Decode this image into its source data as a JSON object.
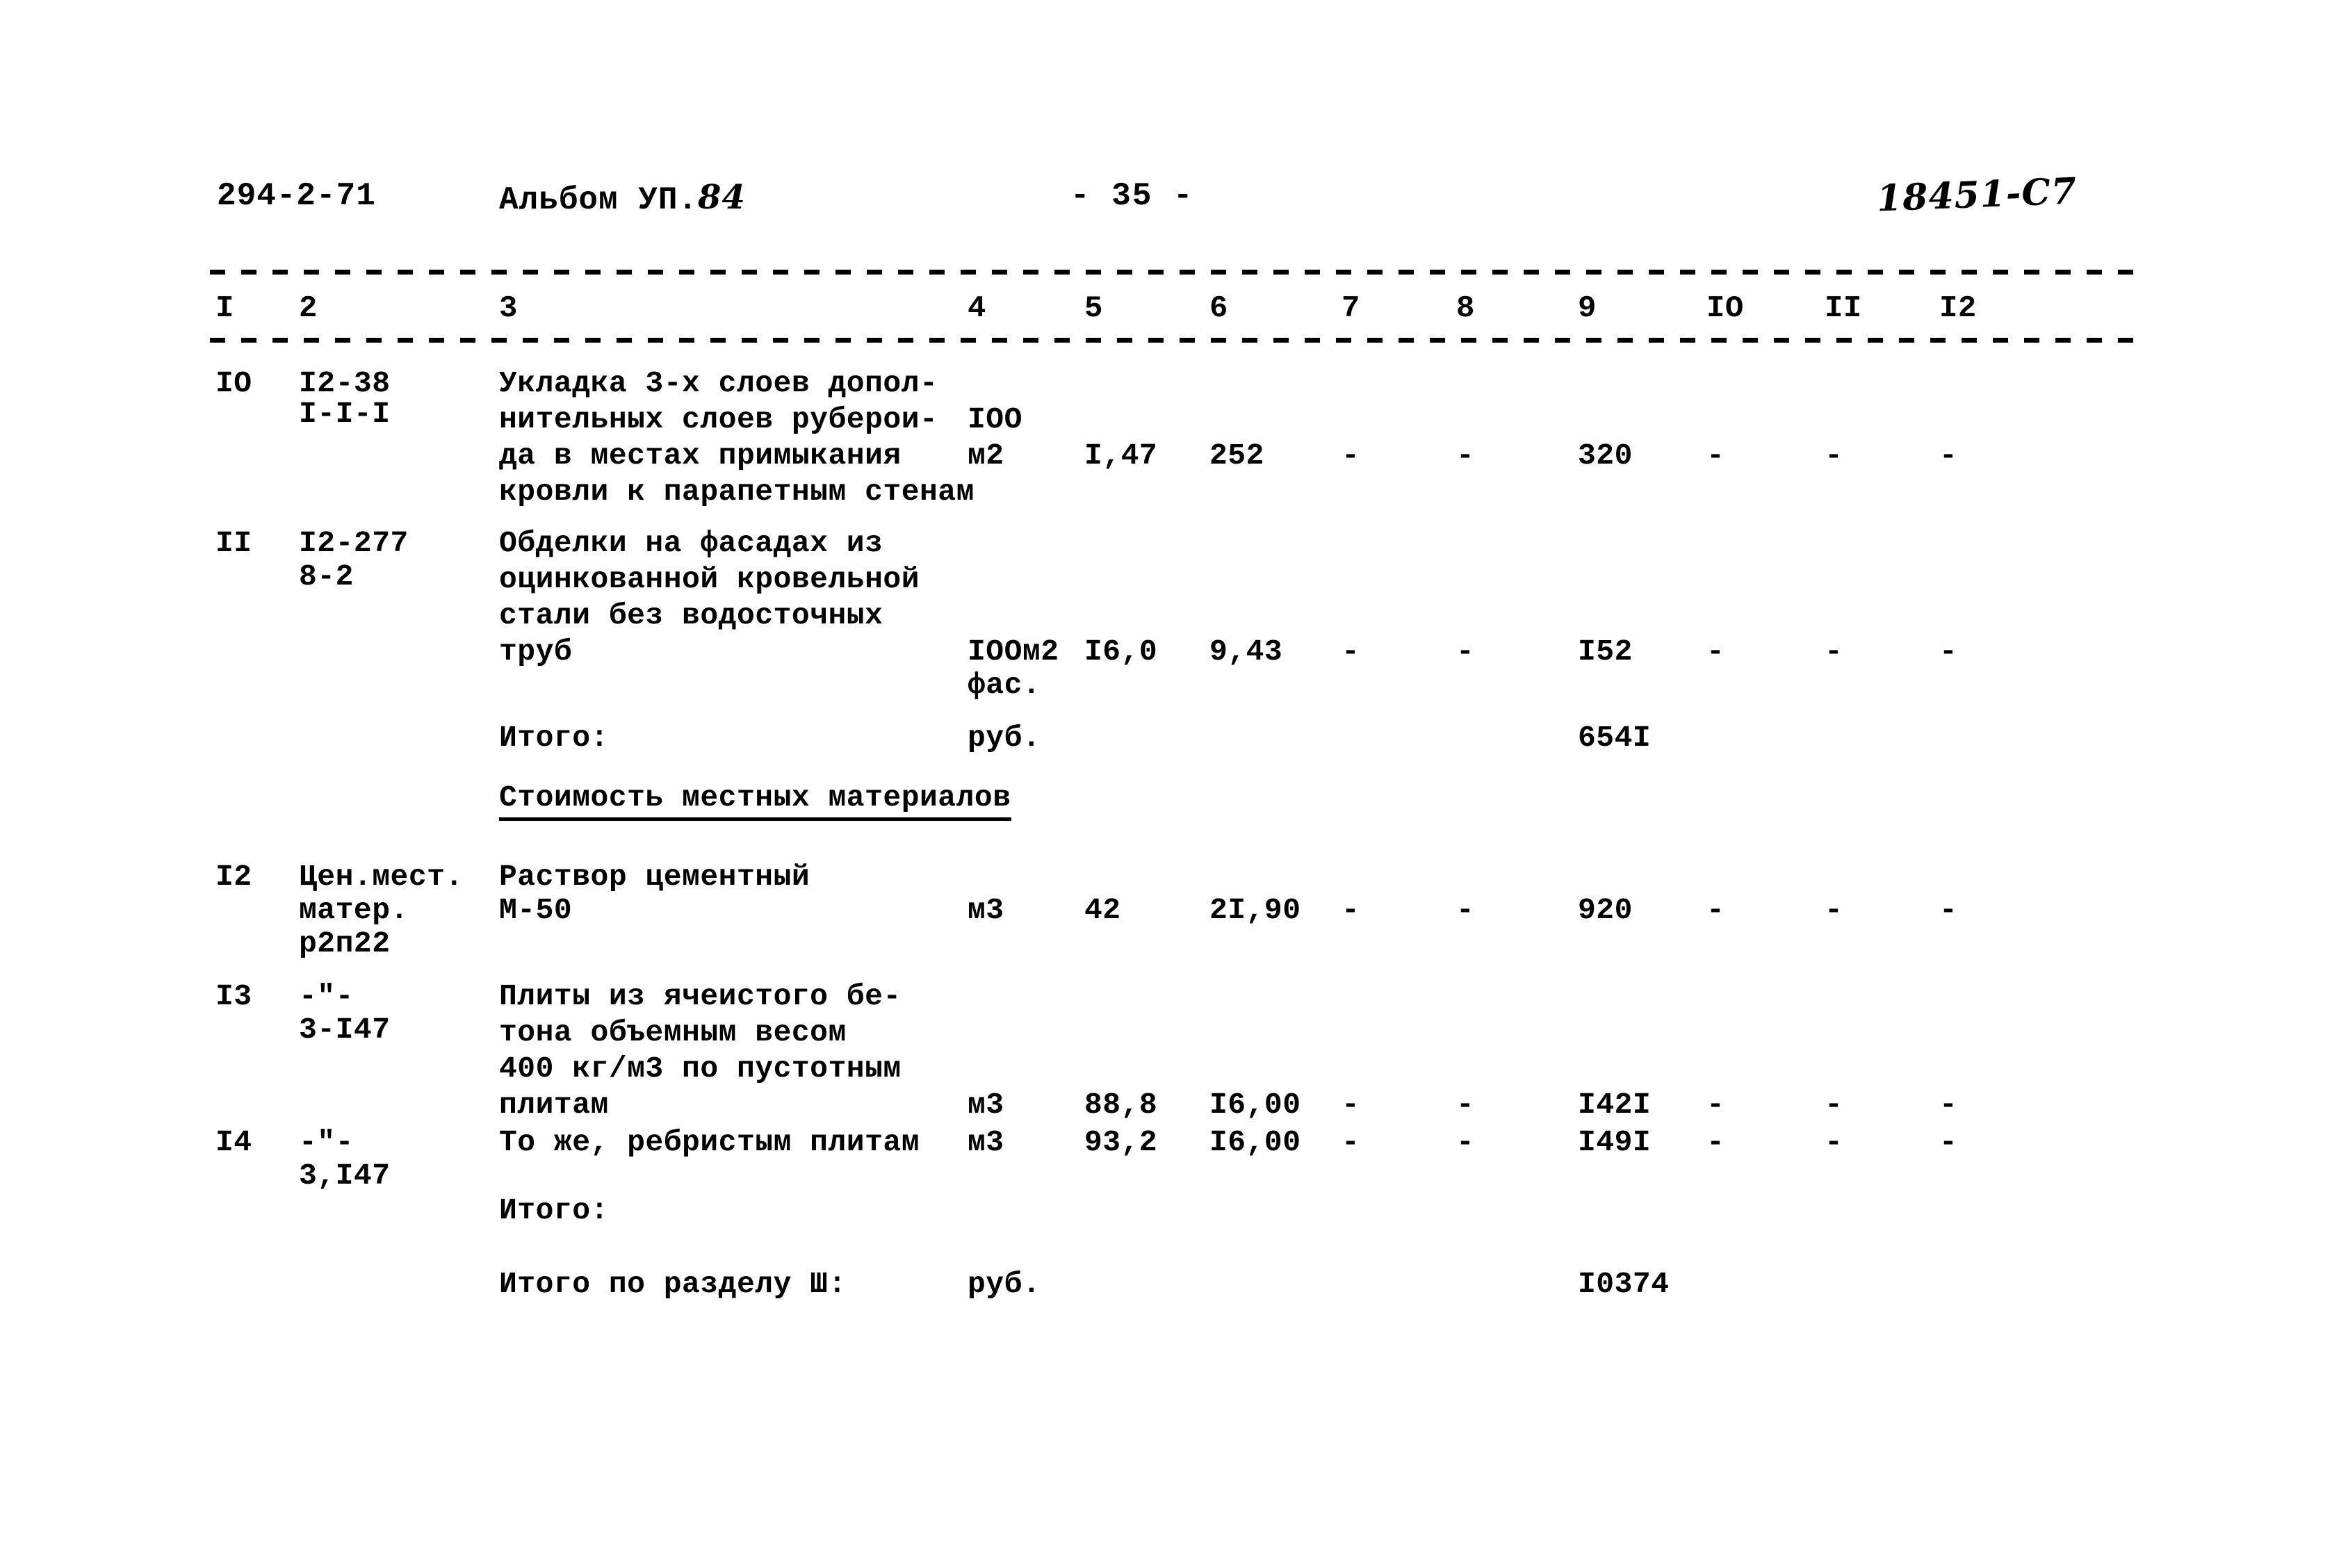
{
  "header": {
    "doc_code": "294-2-71",
    "album_label": "Альбом УП.",
    "album_number": "84",
    "page_marker": "- 35 -",
    "stamp": "18451-С7"
  },
  "table": {
    "column_numbers": [
      "I",
      "2",
      "3",
      "4",
      "5",
      "6",
      "7",
      "8",
      "9",
      "IO",
      "II",
      "I2"
    ],
    "rows": [
      {
        "num": "IO",
        "code_lines": [
          "I2-38",
          "I-I-I"
        ],
        "description_lines": [
          "Укладка 3-х слоев допол-",
          "нительных слоев руберои-",
          "да в местах примыкания",
          "кровли к парапетным стенам"
        ],
        "unit_lines": [
          "IOO",
          "м2"
        ],
        "qty": "I,47",
        "price": "252",
        "c7": "-",
        "c8": "-",
        "total": "320",
        "c10": "-",
        "c11": "-",
        "c12": "-"
      },
      {
        "num": "II",
        "code_lines": [
          "I2-277",
          "8-2"
        ],
        "description_lines": [
          "Обделки на фасадах из",
          "оцинкованной кровельной",
          "стали без водосточных",
          "труб"
        ],
        "unit_lines": [
          "IOOм2",
          "фас."
        ],
        "qty": "I6,0",
        "price": "9,43",
        "c7": "-",
        "c8": "-",
        "total": "I52",
        "c10": "-",
        "c11": "-",
        "c12": "-"
      },
      {
        "num": "I2",
        "code_lines": [
          "Цен.мест.",
          "матер.",
          "р2п22"
        ],
        "description_lines": [
          "Раствор цементный",
          "М-50"
        ],
        "unit_lines": [
          "м3"
        ],
        "qty": "42",
        "price": "2I,90",
        "c7": "-",
        "c8": "-",
        "total": "920",
        "c10": "-",
        "c11": "-",
        "c12": "-"
      },
      {
        "num": "I3",
        "code_lines": [
          "-\"-",
          "3-I47"
        ],
        "description_lines": [
          "Плиты из ячеистого бе-",
          "тона объемным весом",
          "400 кг/м3 по пустотным",
          "плитам"
        ],
        "unit_lines": [
          "м3"
        ],
        "qty": "88,8",
        "price": "I6,00",
        "c7": "-",
        "c8": "-",
        "total": "I42I",
        "c10": "-",
        "c11": "-",
        "c12": "-"
      },
      {
        "num": "I4",
        "code_lines": [
          "-\"-",
          "3,I47"
        ],
        "description_lines": [
          "То же, ребристым плитам"
        ],
        "unit_lines": [
          "м3"
        ],
        "qty": "93,2",
        "price": "I6,00",
        "c7": "-",
        "c8": "-",
        "total": "I49I",
        "c10": "-",
        "c11": "-",
        "c12": "-"
      }
    ],
    "subtotal_1": {
      "label": "Итого:",
      "unit": "руб.",
      "value": "654I"
    },
    "section_heading": "Стоимость местных материалов",
    "subtotal_2": {
      "label": "Итого:",
      "unit": "",
      "value": ""
    },
    "section_total": {
      "label": "Итого по разделу Ш:",
      "unit": "руб.",
      "value": "I0374"
    }
  }
}
